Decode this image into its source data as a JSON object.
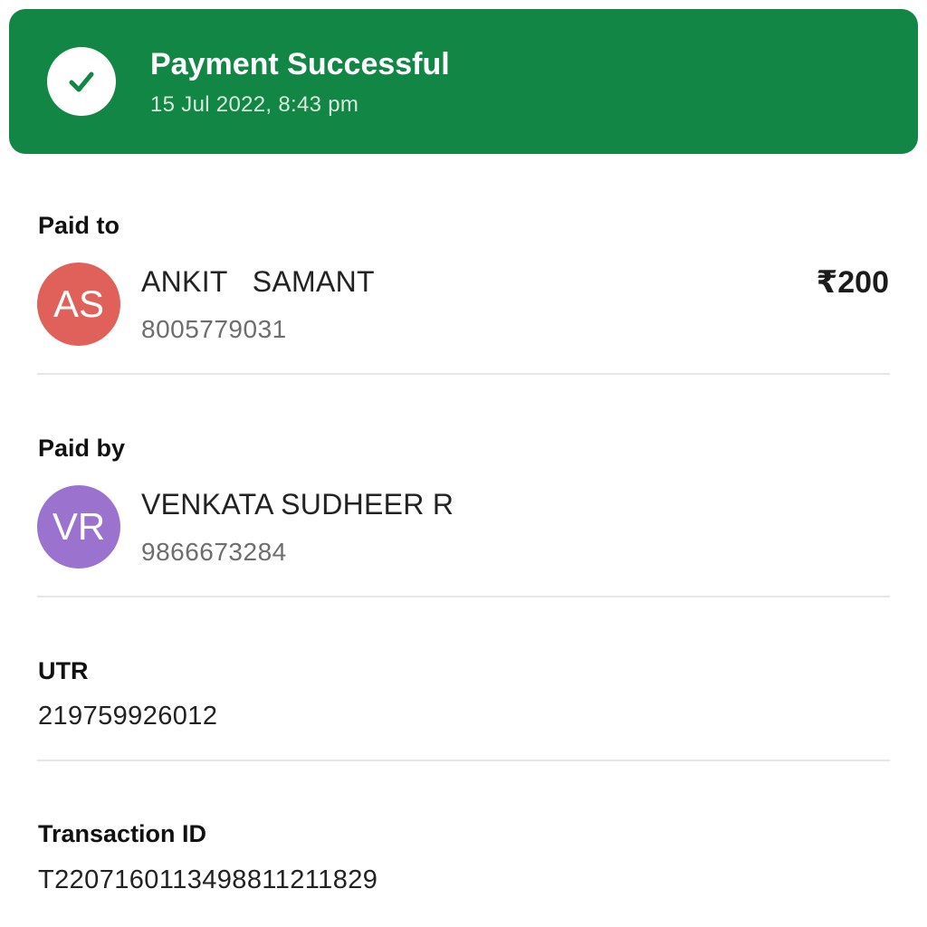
{
  "header": {
    "title": "Payment Successful",
    "datetime": "15 Jul 2022, 8:43 pm",
    "status_icon": "checkmark-icon",
    "color": "#128644"
  },
  "paid_to": {
    "label": "Paid to",
    "initials": "AS",
    "name": "ANKIT   SAMANT",
    "phone": "8005779031",
    "amount": "₹200",
    "avatar_color": "#E0605A"
  },
  "paid_by": {
    "label": "Paid by",
    "initials": "VR",
    "name": "VENKATA SUDHEER R",
    "phone": "9866673284",
    "avatar_color": "#9B73CF"
  },
  "utr": {
    "label": "UTR",
    "value": "219759926012"
  },
  "transaction": {
    "label": "Transaction ID",
    "value": "T2207160113498811211829"
  }
}
